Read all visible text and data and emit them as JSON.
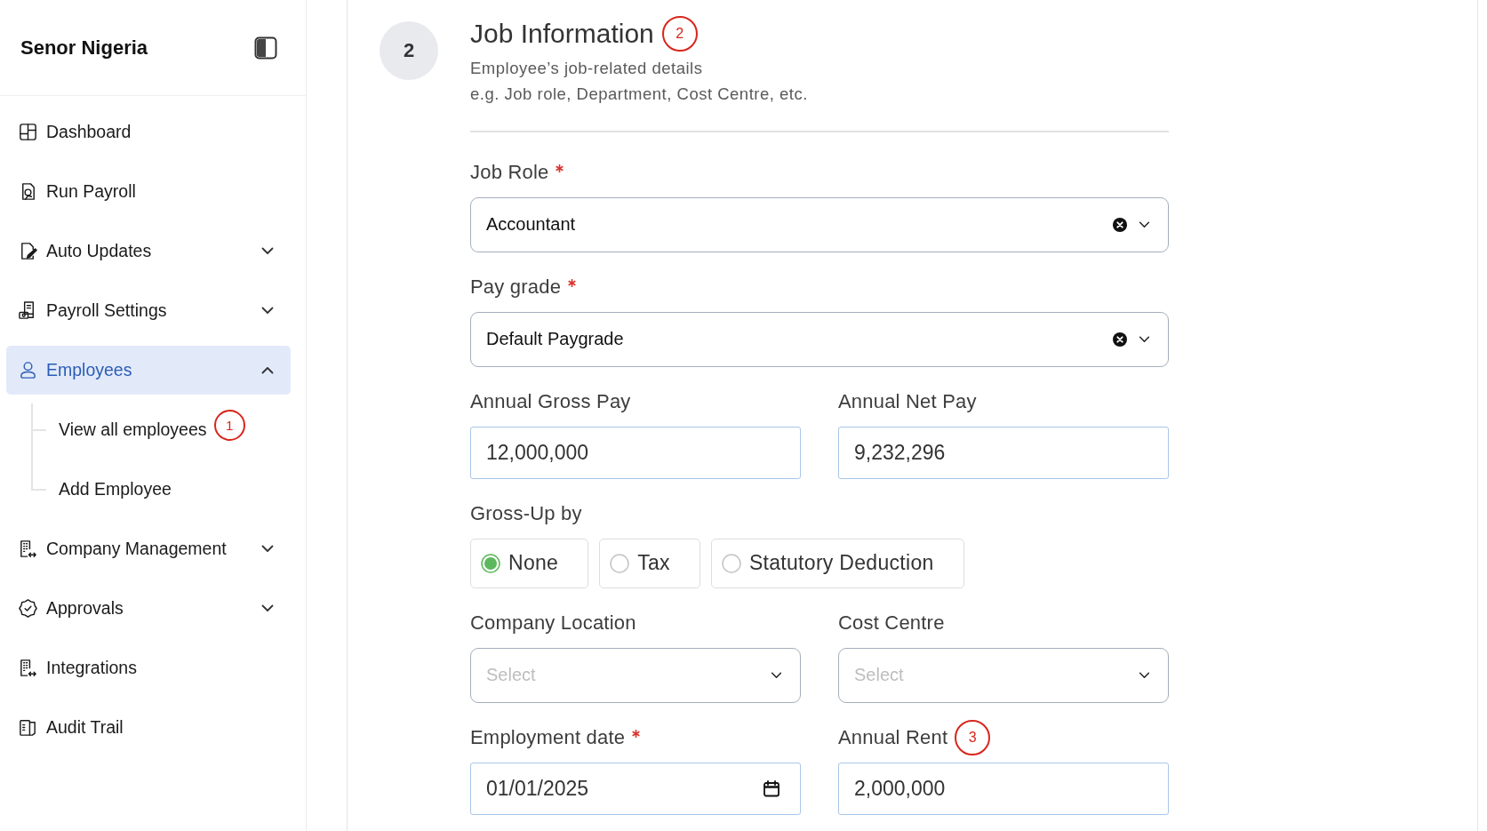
{
  "sidebar": {
    "company_name": "Senor Nigeria",
    "items": [
      {
        "label": "Dashboard",
        "kind": "link",
        "selected": false
      },
      {
        "label": "Run Payroll",
        "kind": "link",
        "selected": false
      },
      {
        "label": "Auto Updates",
        "kind": "group",
        "selected": false,
        "expanded": false
      },
      {
        "label": "Payroll Settings",
        "kind": "group",
        "selected": false,
        "expanded": false
      },
      {
        "label": "Employees",
        "kind": "group",
        "selected": true,
        "expanded": true,
        "children": [
          {
            "label": "View all employees",
            "selected": false,
            "marker": "1"
          },
          {
            "label": "Add Employee",
            "selected": false
          }
        ]
      },
      {
        "label": "Company Management",
        "kind": "group",
        "selected": false,
        "expanded": false
      },
      {
        "label": "Approvals",
        "kind": "group",
        "selected": false,
        "expanded": false
      },
      {
        "label": "Integrations",
        "kind": "link",
        "selected": false
      },
      {
        "label": "Audit Trail",
        "kind": "link",
        "selected": false
      }
    ]
  },
  "step": {
    "number": "2",
    "title": "Job Information",
    "marker": "2",
    "description": [
      "Employee’s job-related details",
      "e.g. Job role, Department, Cost Centre, etc."
    ]
  },
  "form_rows": [
    {
      "fields": [
        {
          "kind": "select",
          "label": "Job Role",
          "required": true,
          "value": "Accountant",
          "clearable": true
        }
      ]
    },
    {
      "fields": [
        {
          "kind": "select",
          "label": "Pay grade",
          "required": true,
          "value": "Default Paygrade",
          "clearable": true
        }
      ]
    },
    {
      "fields": [
        {
          "kind": "text",
          "label": "Annual Gross Pay",
          "required": false,
          "value": "12,000,000"
        },
        {
          "kind": "text",
          "label": "Annual Net Pay",
          "required": false,
          "value": "9,232,296"
        }
      ]
    },
    {
      "fields": [
        {
          "kind": "radio",
          "label": "Gross-Up by",
          "required": false,
          "options": [
            {
              "label": "None",
              "selected": true
            },
            {
              "label": "Tax",
              "selected": false
            },
            {
              "label": "Statutory Deduction",
              "selected": false
            }
          ]
        }
      ]
    },
    {
      "fields": [
        {
          "kind": "select",
          "label": "Company Location",
          "required": false,
          "placeholder": "Select",
          "clearable": false
        },
        {
          "kind": "select",
          "label": "Cost Centre",
          "required": false,
          "placeholder": "Select",
          "clearable": false
        }
      ]
    },
    {
      "fields": [
        {
          "kind": "date",
          "label": "Employment date",
          "required": true,
          "value": "01/01/2025"
        },
        {
          "kind": "text",
          "label": "Annual Rent",
          "required": false,
          "value": "2,000,000",
          "marker": "3"
        }
      ]
    }
  ]
}
